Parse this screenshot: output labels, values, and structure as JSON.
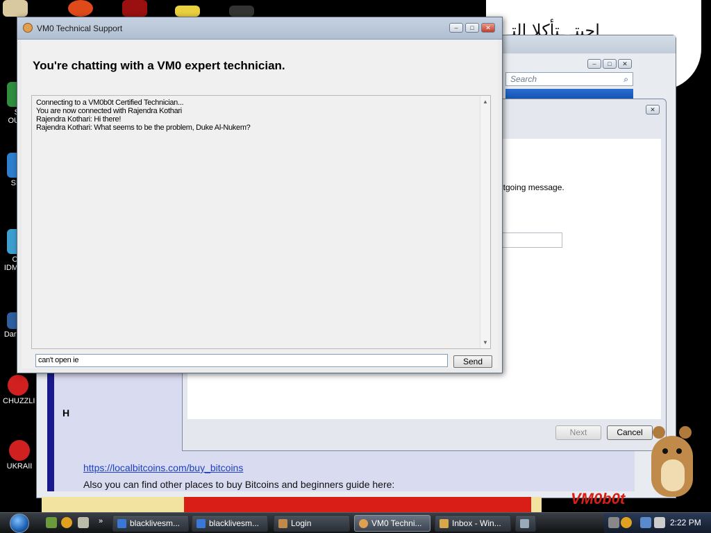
{
  "desktop": {
    "icons": [
      {
        "label": "S\nOU",
        "color": "#2f8f3f"
      },
      {
        "label": "SI",
        "color": "#2f7fcf"
      },
      {
        "label": "O\nIDM",
        "color": "#3fa0d0"
      },
      {
        "label": "Darl",
        "color": "#2f5f9f"
      },
      {
        "label": "CHUZZLI",
        "color": "#d02020"
      },
      {
        "label": "UKRAII",
        "color": "#d02020"
      }
    ],
    "background_arabic": "احبتـ ـتأكلا التـ",
    "brand_text": "VM0b0t"
  },
  "bg_browser": {
    "search_placeholder": "Search",
    "heading_fragment": "H",
    "link": "https://localbitcoins.com/buy_bitcoins",
    "text": "Also you can find other places to buy Bitcoins and beginners guide here:"
  },
  "wizard": {
    "text_fragment": "utgoing message.",
    "next_label": "Next",
    "cancel_label": "Cancel"
  },
  "chat": {
    "window_title": "VM0 Technical Support",
    "heading": "You're chatting with a VM0 expert technician.",
    "log": [
      "Connecting to a VM0b0t Certified Technician...",
      "You are now connected with Rajendra Kothari",
      "Rajendra Kothari: Hi there!",
      "Rajendra Kothari: What seems to be the problem, Duke Al-Nukem?"
    ],
    "input_value": "can't open ie",
    "send_label": "Send"
  },
  "taskbar": {
    "items": [
      {
        "label": "blacklivesm...",
        "icon_color": "#3a78d8"
      },
      {
        "label": "blacklivesm...",
        "icon_color": "#3a78d8"
      },
      {
        "label": "Login",
        "icon_color": "#c08a4a"
      },
      {
        "label": "VM0 Techni...",
        "icon_color": "#e0a050"
      },
      {
        "label": "Inbox - Win...",
        "icon_color": "#d8a84a"
      },
      {
        "label": "",
        "icon_color": "#9ab"
      }
    ],
    "clock": "2:22 PM"
  }
}
